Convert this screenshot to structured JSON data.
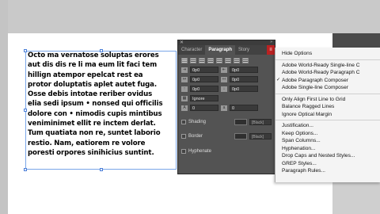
{
  "document": {
    "paragraph_lines": [
      "Octo ma vernatose soluptas erores",
      "aut dis dis re li ma eum lit faci tem",
      "hillign atempor epelcat rest ea",
      "protor doluptatis aplet autet fuga.",
      "Osse debis intotae reriber ovidus",
      "elia sedi ipsum • nonsed qui officilis",
      "dolore con • nimodis cupis mintibus",
      "veniminimet ellit re inctem derlat.",
      "Tum quatiata non re, suntet laborio",
      "restio. Nam, eatiorem re volore",
      "poresti orpores sinihicius suntint."
    ]
  },
  "panel": {
    "tabs": [
      {
        "label": "Character",
        "active": false
      },
      {
        "label": "Paragraph",
        "active": true
      },
      {
        "label": "Story",
        "active": false
      }
    ],
    "fields": {
      "left_indent": "0p0",
      "right_indent": "0p0",
      "first_line_indent": "0p0",
      "last_line_indent": "0p0",
      "space_before": "0p0",
      "space_after": "0p0",
      "drop_cap_lines": "0",
      "drop_cap_chars": "0",
      "align_grid": "Ignore"
    },
    "shading_label": "Shading",
    "border_label": "Border",
    "shading_color": "[Black]",
    "border_color": "[Black]",
    "hyphenate_label": "Hyphenate"
  },
  "menu": {
    "items": [
      {
        "label": "Hide Options",
        "checked": false
      },
      {
        "sep": true
      },
      {
        "label": "Adobe World-Ready Single-line C",
        "checked": false
      },
      {
        "label": "Adobe World-Ready Paragraph C",
        "checked": false
      },
      {
        "label": "Adobe Paragraph Composer",
        "checked": true
      },
      {
        "label": "Adobe Single-line Composer",
        "checked": false
      },
      {
        "sep": true
      },
      {
        "label": "Only Align First Line to Grid",
        "checked": false
      },
      {
        "label": "Balance Ragged Lines",
        "checked": false
      },
      {
        "label": "Ignore Optical Margin",
        "checked": false
      },
      {
        "sep": true
      },
      {
        "label": "Justification...",
        "checked": false
      },
      {
        "label": "Keep Options...",
        "checked": false
      },
      {
        "label": "Span Columns...",
        "checked": false
      },
      {
        "label": "Hyphenation...",
        "checked": false
      },
      {
        "label": "Drop Caps and Nested Styles...",
        "checked": false
      },
      {
        "label": "GREP Styles...",
        "checked": false
      },
      {
        "label": "Paragraph Rules...",
        "checked": false
      }
    ]
  },
  "colors": {
    "panel_bg": "#535353",
    "menu_button": "#b22222",
    "selection_frame": "#7aa6e8"
  }
}
